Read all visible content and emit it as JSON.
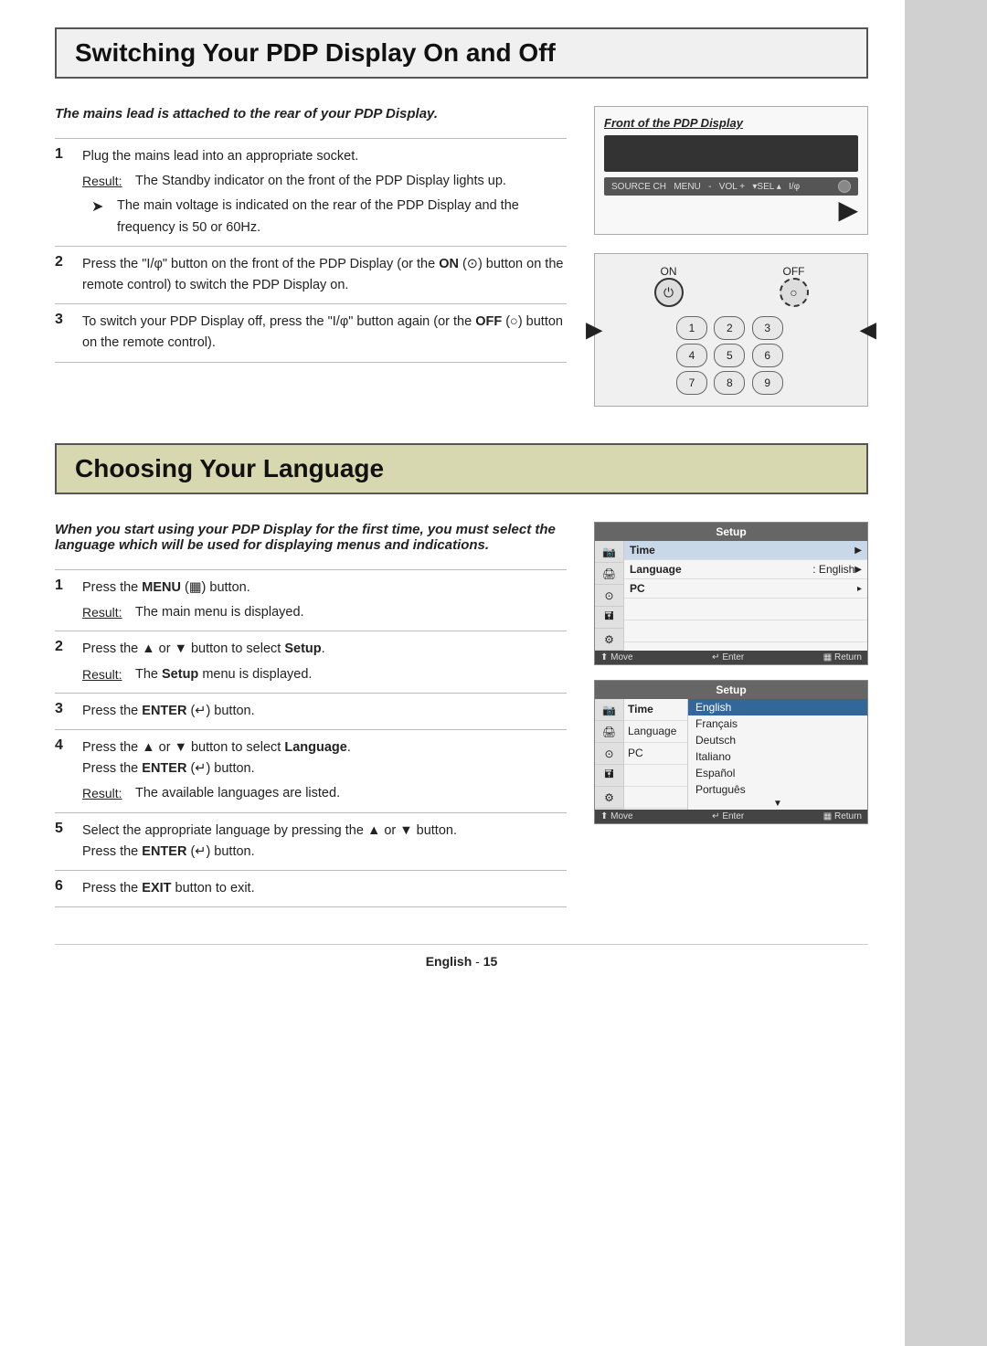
{
  "page": {
    "background": "#ffffff"
  },
  "section1": {
    "title": "Switching Your PDP Display On and Off",
    "intro_bold": "The mains lead is attached to the rear of your PDP Display.",
    "steps": [
      {
        "num": "1",
        "text": "Plug the mains lead into an appropriate socket.",
        "result": "The Standby indicator on the front of the PDP Display lights up.",
        "note": "The main voltage is indicated on the rear of the PDP Display and the frequency is 50 or 60Hz."
      },
      {
        "num": "2",
        "text_start": "Press the “Ⅰ/ф” button on the front of the PDP Display (or the ",
        "text_bold": "ON",
        "text_end": " (◎) button on the remote control) to switch the PDP Display on."
      },
      {
        "num": "3",
        "text_start": "To switch your PDP Display off, press the “Ⅰ/ф” button again (or the ",
        "text_bold": "OFF",
        "text_end": " (○) button on the remote control)."
      }
    ],
    "right_panel": {
      "front_label": "Front of the PDP Display",
      "controls_label": "SOURCE CH  MENU  -  VOL +  ▾SEL ▴  I/ф",
      "on_label": "ON",
      "off_label": "OFF",
      "num_buttons": [
        "1",
        "2",
        "3",
        "4",
        "5",
        "6",
        "7",
        "8",
        "9"
      ]
    }
  },
  "section2": {
    "title": "Choosing Your Language",
    "intro_bold": "When you start using your PDP Display for the first time, you must select the language which will be used for displaying menus and indications.",
    "steps": [
      {
        "num": "1",
        "text_start": "Press the ",
        "text_bold": "MENU",
        "text_symbol": " (☐☐☐)",
        "text_end": " button.",
        "result": "The main menu is displayed."
      },
      {
        "num": "2",
        "text_start": "Press the ▲ or ▼ button to select ",
        "text_bold": "Setup",
        "text_end": ".",
        "result_start": "The ",
        "result_bold": "Setup",
        "result_end": " menu is displayed."
      },
      {
        "num": "3",
        "text_start": "Press the ",
        "text_bold": "ENTER",
        "text_end": " (↵) button."
      },
      {
        "num": "4",
        "text_start": "Press the ▲ or ▼ button to select ",
        "text_bold": "Language",
        "text_end": ".",
        "text2_start": "Press the ",
        "text2_bold": "ENTER",
        "text2_end": " (↵) button.",
        "result": "The available languages are listed."
      },
      {
        "num": "5",
        "text_start": "Select the appropriate language by pressing the ▲ or ▼ button.",
        "text2_start": "Press the ",
        "text2_bold": "ENTER",
        "text2_end": " (↵) button."
      },
      {
        "num": "6",
        "text_start": "Press the ",
        "text_bold": "EXIT",
        "text_end": " button to exit."
      }
    ],
    "setup_menu1": {
      "header": "Setup",
      "rows": [
        {
          "label": "Time",
          "value": "",
          "arrow": "▶",
          "bold": true
        },
        {
          "label": "Language",
          "value": ": English",
          "arrow": "▶",
          "bold": false,
          "highlight": false
        },
        {
          "label": "PC",
          "value": "",
          "arrow": "▸",
          "bold": false
        },
        {
          "label": "",
          "value": "",
          "icon": "camera"
        },
        {
          "label": "",
          "value": "",
          "icon": "music"
        },
        {
          "label": "",
          "value": "",
          "icon": "gear"
        }
      ],
      "footer": "⬆ Move  ↵ Enter  ▦ Return"
    },
    "setup_menu2": {
      "header": "Setup",
      "languages": [
        "English",
        "Français",
        "Deutsch",
        "Italiano",
        "Español",
        "Português"
      ],
      "selected": "English",
      "left_labels": [
        "Time",
        "Language",
        "PC"
      ],
      "footer": "⬆ Move  ↵ Enter  ▦ Return"
    }
  },
  "footer": {
    "text": "English",
    "page_num": "15"
  }
}
